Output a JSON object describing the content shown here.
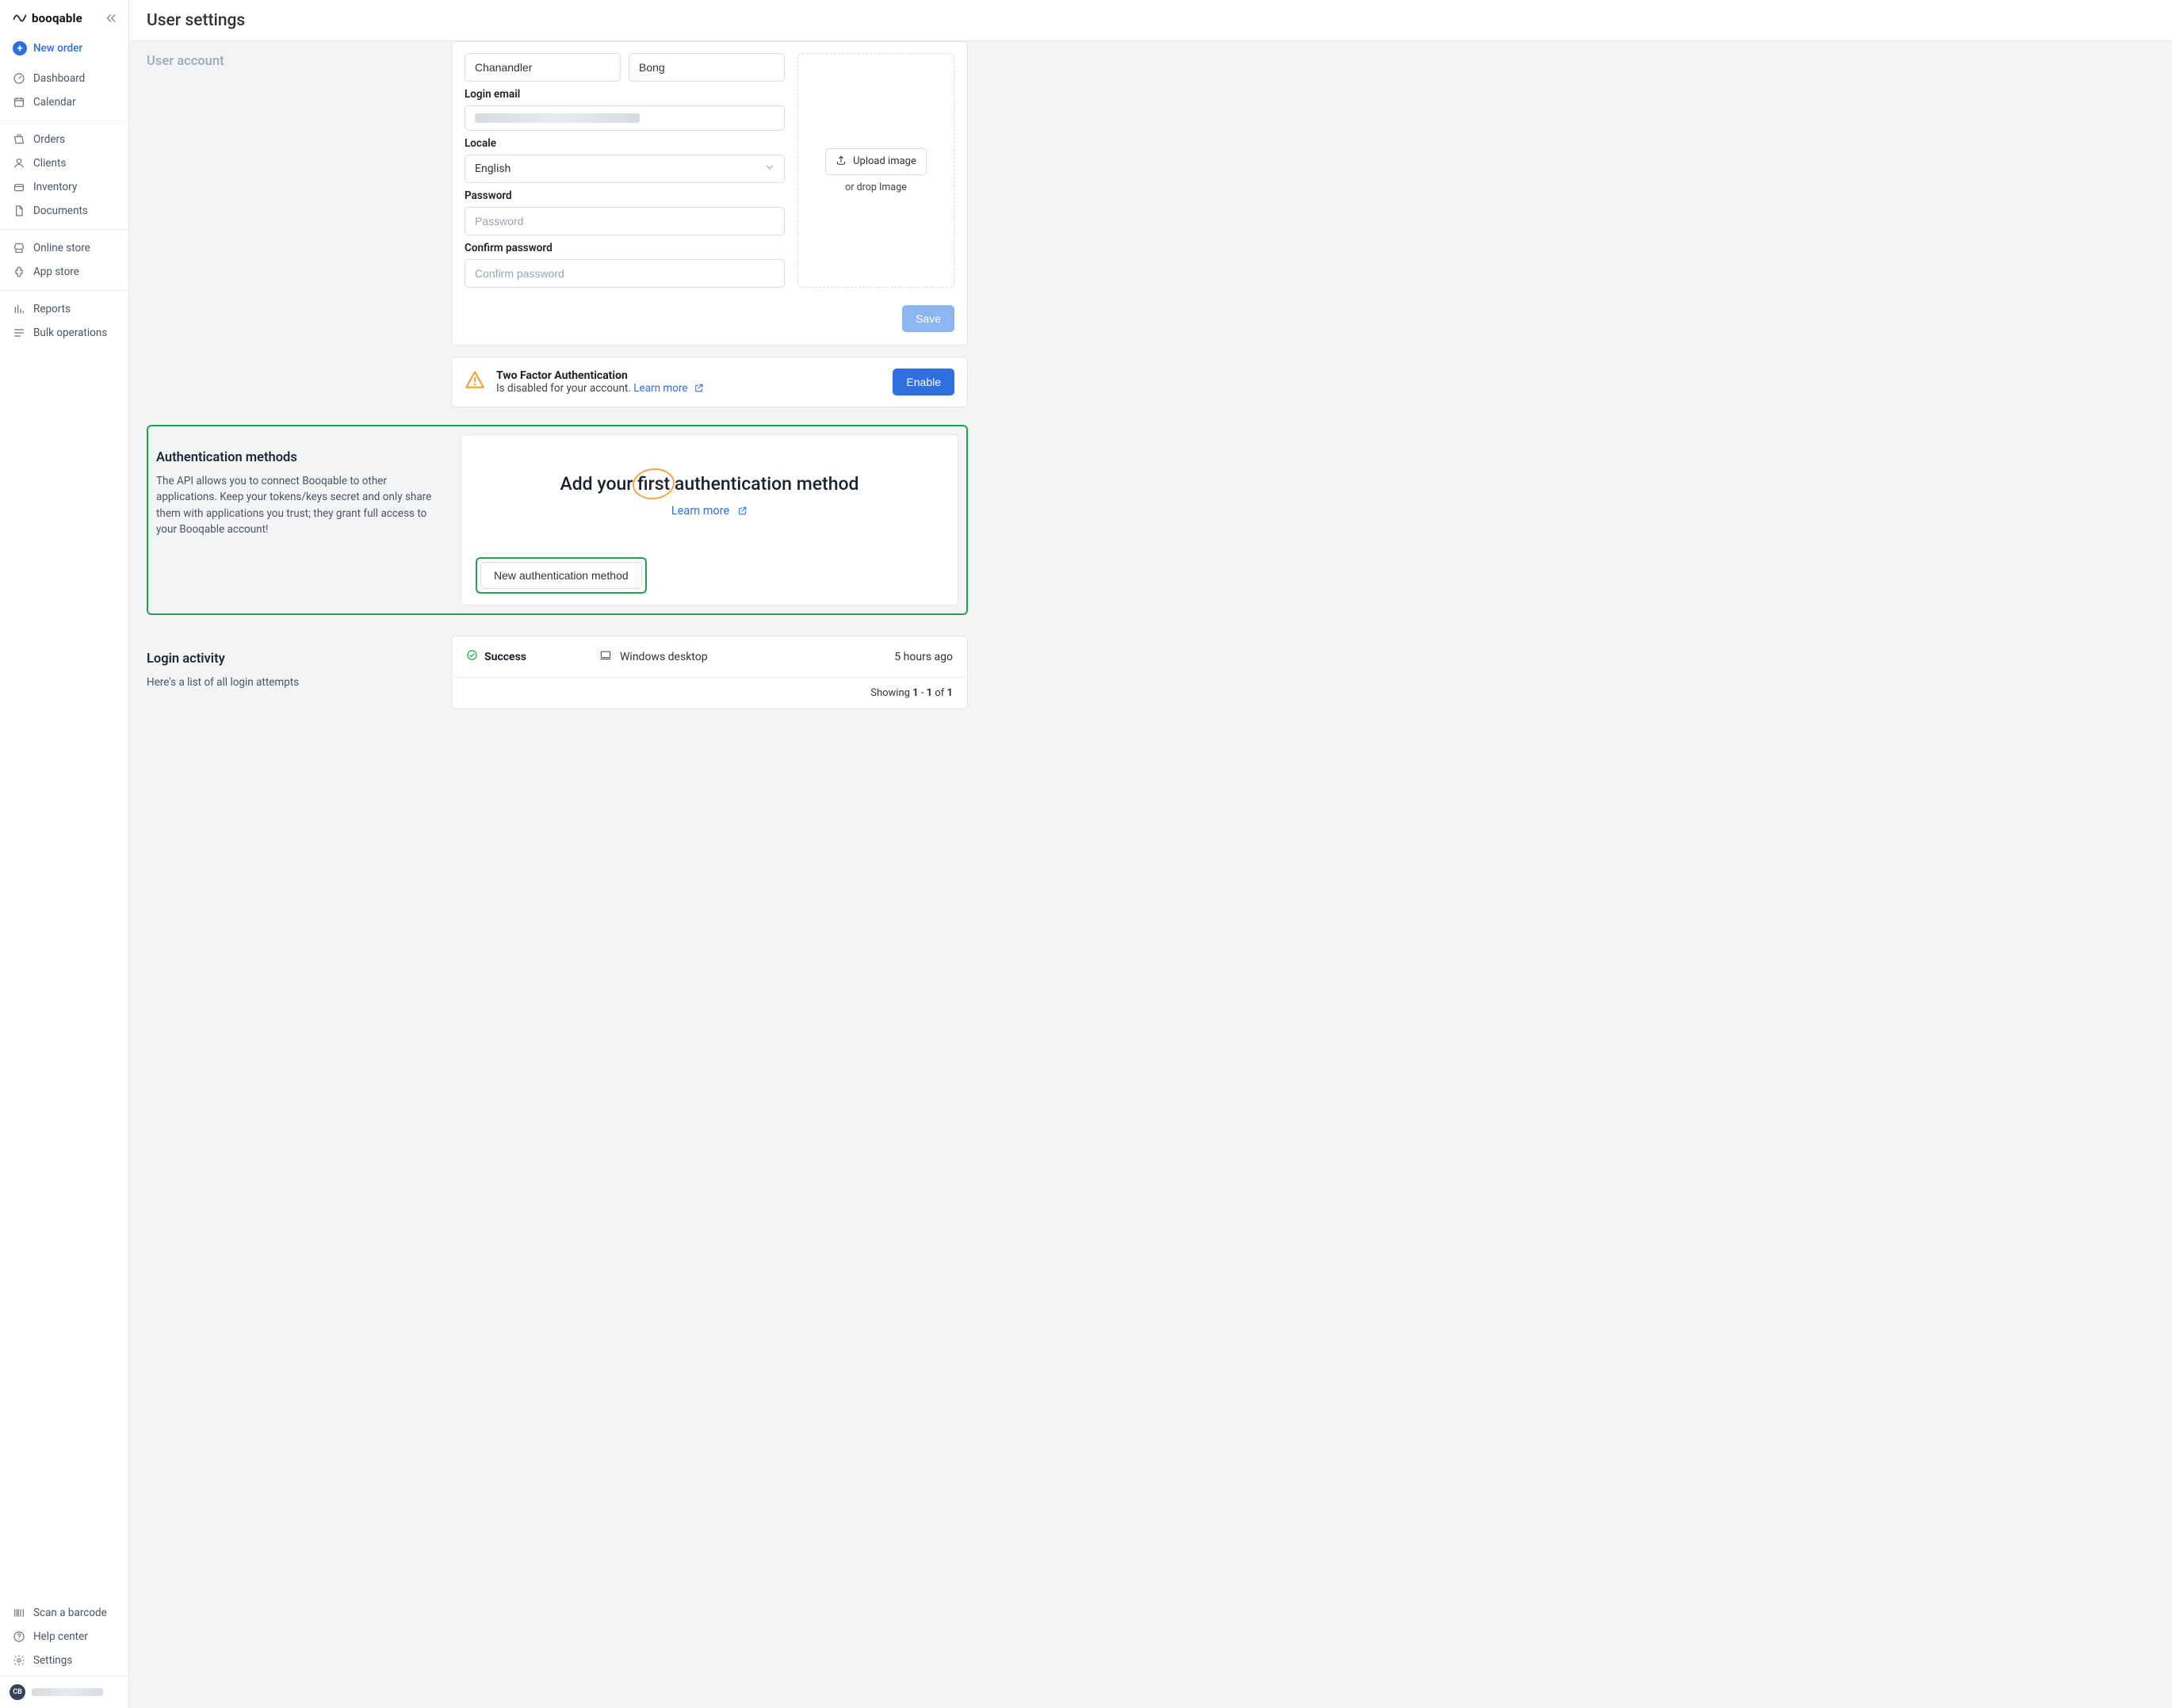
{
  "brand": {
    "name": "booqable"
  },
  "page_title": "User settings",
  "sidebar": {
    "new_order": "New order",
    "items1": [
      {
        "label": "Dashboard"
      },
      {
        "label": "Calendar"
      }
    ],
    "items2": [
      {
        "label": "Orders"
      },
      {
        "label": "Clients"
      },
      {
        "label": "Inventory"
      },
      {
        "label": "Documents"
      }
    ],
    "items3": [
      {
        "label": "Online store"
      },
      {
        "label": "App store"
      }
    ],
    "items4": [
      {
        "label": "Reports"
      },
      {
        "label": "Bulk operations"
      }
    ],
    "bottom": [
      {
        "label": "Scan a barcode"
      },
      {
        "label": "Help center"
      },
      {
        "label": "Settings"
      }
    ],
    "user_initials": "CB"
  },
  "user_account": {
    "section_title": "User account",
    "first_name": "Chanandler",
    "last_name": "Bong",
    "login_email_label": "Login email",
    "locale_label": "Locale",
    "locale_value": "English",
    "password_label": "Password",
    "password_placeholder": "Password",
    "confirm_label": "Confirm password",
    "confirm_placeholder": "Confirm password",
    "upload_btn": "Upload image",
    "upload_hint": "or drop Image",
    "save_btn": "Save"
  },
  "tfa": {
    "title": "Two Factor Authentication",
    "subtitle": "Is disabled for your account.",
    "learn_more": "Learn more",
    "enable_btn": "Enable"
  },
  "auth_methods": {
    "section_title": "Authentication methods",
    "section_desc": "The API allows you to connect Booqable to other applications. Keep your tokens/keys secret and only share them with applications you trust; they grant full access to your Booqable account!",
    "headline_before": "Add your ",
    "headline_word": "first",
    "headline_after": " authentication method",
    "learn_more": "Learn more",
    "new_btn": "New authentication method"
  },
  "login_activity": {
    "section_title": "Login activity",
    "section_desc": "Here's a list of all login attempts",
    "status": "Success",
    "device": "Windows desktop",
    "time": "5 hours ago",
    "footer_prefix": "Showing ",
    "footer_from": "1",
    "footer_dash": " - ",
    "footer_to": "1",
    "footer_of": " of ",
    "footer_total": "1"
  }
}
